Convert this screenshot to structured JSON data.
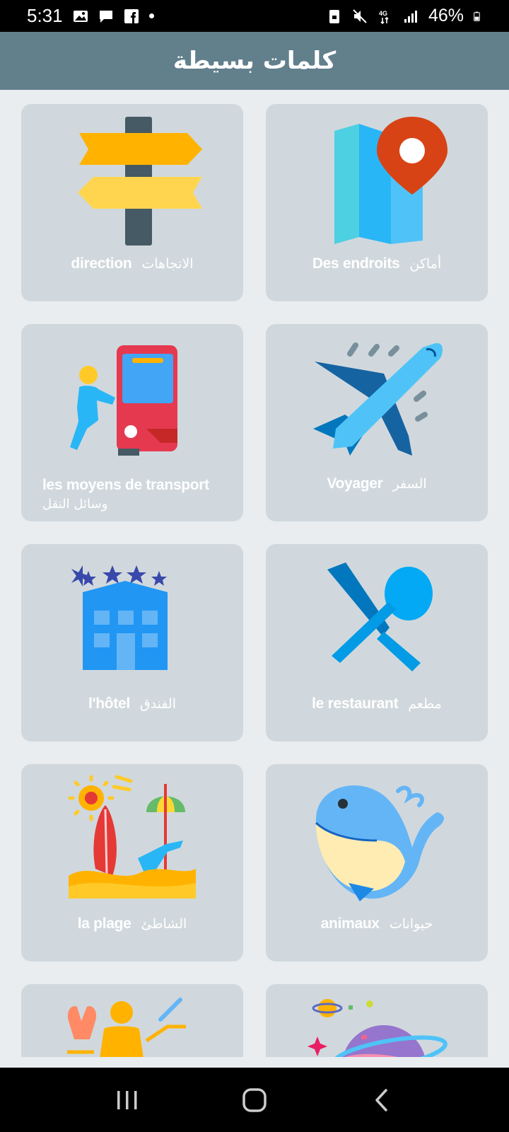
{
  "status_bar": {
    "time": "5:31",
    "battery_percent": "46%",
    "network": "4G"
  },
  "appbar": {
    "title": "كلمات بسيطة"
  },
  "categories": [
    {
      "fr": "direction",
      "ar": "الاتجاهات",
      "icon": "signpost-icon"
    },
    {
      "fr": "Des endroits",
      "ar": "أماكن",
      "icon": "map-pin-icon"
    },
    {
      "fr": "les moyens de transport",
      "ar": "وسائل النقل",
      "icon": "bus-icon"
    },
    {
      "fr": "Voyager",
      "ar": "السفر",
      "icon": "airplane-icon"
    },
    {
      "fr": "l'hôtel",
      "ar": "الفندق",
      "icon": "hotel-icon"
    },
    {
      "fr": "le restaurant",
      "ar": "مطعم",
      "icon": "knife-spoon-icon"
    },
    {
      "fr": "la plage",
      "ar": "الشاطئ",
      "icon": "beach-icon"
    },
    {
      "fr": "animaux",
      "ar": "حيوانات",
      "icon": "whale-icon"
    },
    {
      "fr": "",
      "ar": "",
      "icon": "body-icon"
    },
    {
      "fr": "",
      "ar": "",
      "icon": "planet-icon"
    }
  ],
  "colors": {
    "appbar": "#627f8c",
    "card": "#d0d8dd",
    "background": "#e9edf0"
  }
}
